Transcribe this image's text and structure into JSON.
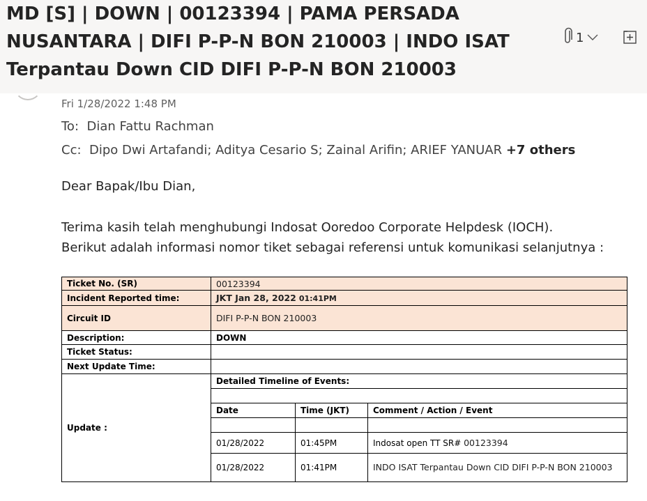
{
  "email": {
    "subject_lines": [
      "MD [S] | DOWN | 00123394 | PAMA PERSADA",
      "NUSANTARA | DIFI P-P-N BON 210003 | INDO ISAT",
      "Terpantau Down CID DIFI P-P-N BON 210003"
    ],
    "attachment_count": "1",
    "date": "Fri 1/28/2022 1:48 PM",
    "to_label": "To:",
    "to": "Dian Fattu Rachman",
    "cc_label": "Cc:",
    "cc": "Dipo Dwi Artafandi; Aditya Cesario S; Zainal Arifin; ARIEF YANUAR",
    "cc_more": "+7 others"
  },
  "body": {
    "greeting": "Dear Bapak/Ibu Dian,",
    "para_line1": "Terima kasih telah menghubungi Indosat Ooredoo Corporate Helpdesk (IOCH).",
    "para_line2": "Berikut adalah informasi nomor tiket sebagai referensi untuk komunikasi selanjutnya :"
  },
  "ticket": {
    "ticket_no_label": "Ticket No. (SR)",
    "ticket_no": "00123394",
    "reported_label": "Incident Reported time:",
    "reported_date": "JKT Jan 28, 2022",
    "reported_time": "01:41PM",
    "circuit_label": "Circuit ID",
    "circuit_id": "DIFI P-P-N BON 210003",
    "description_label": "Description:",
    "description": "DOWN",
    "status_label": "Ticket Status:",
    "status": "",
    "next_update_label": "Next Update Time:",
    "next_update": "",
    "update_label": "Update :",
    "timeline_title": "Detailed Timeline of Events:",
    "headers": [
      "Date",
      "Time (JKT)",
      "Comment / Action / Event"
    ],
    "rows": [
      {
        "date": "01/28/2022",
        "time": "01:45PM",
        "comment_prefix": "Indosat open TT SR#",
        "comment_value": "00123394"
      },
      {
        "date": "01/28/2022",
        "time": "01:41PM",
        "comment_prefix": "",
        "comment_value": "INDO ISAT Terpantau Down CID DIFI P-P-N BON 210003"
      }
    ]
  },
  "colors": {
    "highlight_row": "#fbe4d5",
    "header_bg": "#f7f6f5"
  }
}
